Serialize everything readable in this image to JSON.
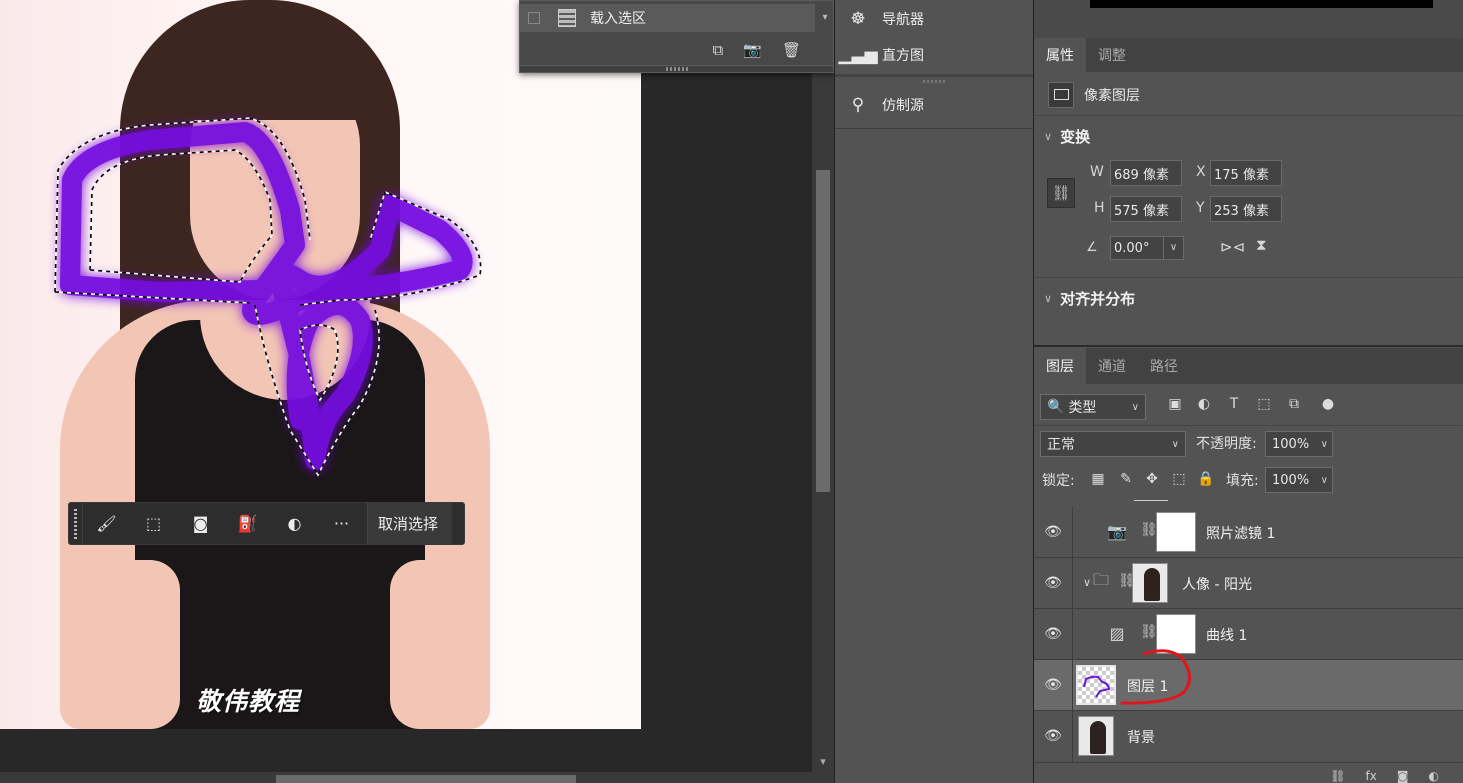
{
  "canvas": {
    "watermark": "敬伟教程",
    "context_taskbar": {
      "deselect_label": "取消选择",
      "more_label": "···"
    }
  },
  "actions_panel": {
    "action_label": "载入选区"
  },
  "mid_panels": [
    {
      "label": "导航器",
      "icon": "navigator-icon"
    },
    {
      "label": "直方图",
      "icon": "histogram-icon"
    },
    {
      "label": "仿制源",
      "icon": "clone-source-icon"
    }
  ],
  "properties": {
    "tabs": [
      "属性",
      "调整"
    ],
    "layer_type": "像素图层",
    "transform": {
      "title": "变换",
      "w_label": "W",
      "w_value": "689 像素",
      "h_label": "H",
      "h_value": "575 像素",
      "x_label": "X",
      "x_value": "175 像素",
      "y_label": "Y",
      "y_value": "253 像素",
      "angle_value": "0.00°"
    },
    "align": {
      "title": "对齐并分布"
    }
  },
  "layers_panel": {
    "tabs": [
      "图层",
      "通道",
      "路径"
    ],
    "filter_kind": "类型",
    "blend_mode": "正常",
    "opacity_label": "不透明度:",
    "opacity_value": "100%",
    "lock_label": "锁定:",
    "fill_label": "填充:",
    "fill_value": "100%",
    "layers": [
      {
        "name": "照片滤镜 1"
      },
      {
        "name": "人像 - 阳光"
      },
      {
        "name": "曲线 1"
      },
      {
        "name": "图层 1"
      },
      {
        "name": "背景"
      }
    ]
  },
  "colors": {
    "selection_stroke": "#7a10e6",
    "annotation_red": "#e0161e",
    "panel_bg": "#535353"
  }
}
